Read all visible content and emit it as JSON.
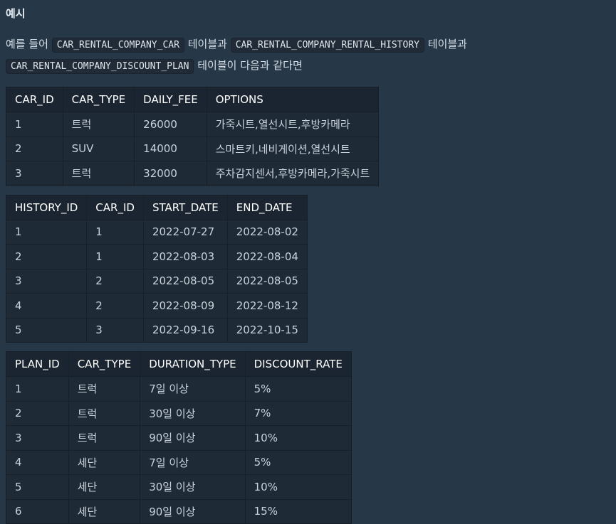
{
  "heading": "예시",
  "intro": {
    "p1": "예를 들어",
    "table1_name": "CAR_RENTAL_COMPANY_CAR",
    "p2": "테이블과",
    "table2_name": "CAR_RENTAL_COMPANY_RENTAL_HISTORY",
    "p3": "테이블과",
    "table3_name": "CAR_RENTAL_COMPANY_DISCOUNT_PLAN",
    "p4": "테이블이 다음과 같다면"
  },
  "car_table": {
    "headers": [
      "CAR_ID",
      "CAR_TYPE",
      "DAILY_FEE",
      "OPTIONS"
    ],
    "rows": [
      [
        "1",
        "트럭",
        "26000",
        "가죽시트,열선시트,후방카메라"
      ],
      [
        "2",
        "SUV",
        "14000",
        "스마트키,네비게이션,열선시트"
      ],
      [
        "3",
        "트럭",
        "32000",
        "주차감지센서,후방카메라,가죽시트"
      ]
    ]
  },
  "history_table": {
    "headers": [
      "HISTORY_ID",
      "CAR_ID",
      "START_DATE",
      "END_DATE"
    ],
    "rows": [
      [
        "1",
        "1",
        "2022-07-27",
        "2022-08-02"
      ],
      [
        "2",
        "1",
        "2022-08-03",
        "2022-08-04"
      ],
      [
        "3",
        "2",
        "2022-08-05",
        "2022-08-05"
      ],
      [
        "4",
        "2",
        "2022-08-09",
        "2022-08-12"
      ],
      [
        "5",
        "3",
        "2022-09-16",
        "2022-10-15"
      ]
    ]
  },
  "plan_table": {
    "headers": [
      "PLAN_ID",
      "CAR_TYPE",
      "DURATION_TYPE",
      "DISCOUNT_RATE"
    ],
    "rows": [
      [
        "1",
        "트럭",
        "7일 이상",
        "5%"
      ],
      [
        "2",
        "트럭",
        "30일 이상",
        "7%"
      ],
      [
        "3",
        "트럭",
        "90일 이상",
        "10%"
      ],
      [
        "4",
        "세단",
        "7일 이상",
        "5%"
      ],
      [
        "5",
        "세단",
        "30일 이상",
        "10%"
      ],
      [
        "6",
        "세단",
        "90일 이상",
        "15%"
      ]
    ]
  }
}
